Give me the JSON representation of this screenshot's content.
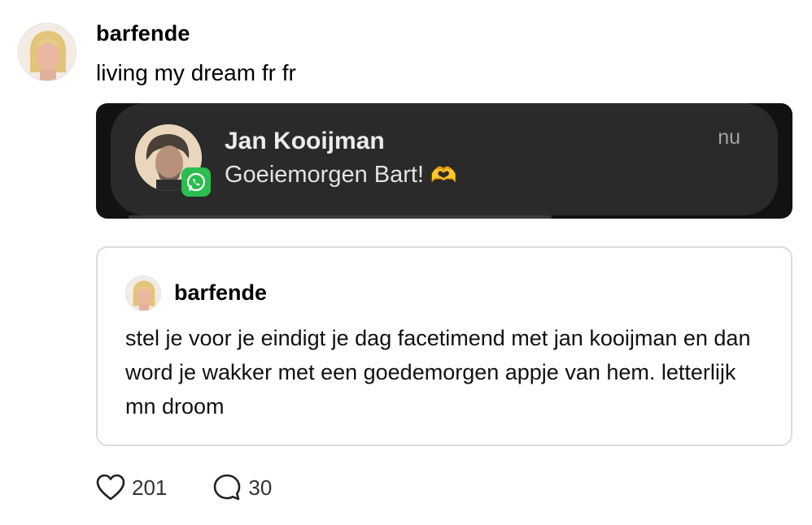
{
  "post": {
    "username": "barfende",
    "text": "living my dream fr fr"
  },
  "notification": {
    "sender": "Jan Kooijman",
    "message": "Goeiemorgen Bart!",
    "emoji": "🫶",
    "time": "nu",
    "app_icon": "whatsapp-icon"
  },
  "quoted_post": {
    "username": "barfende",
    "text": "stel je voor je eindigt je dag facetimend met jan kooijman en dan word je wakker met een goedemorgen appje van hem. letterlijk mn droom"
  },
  "actions": {
    "likes": "201",
    "comments": "30"
  },
  "colors": {
    "whatsapp_green": "#2bbd4f",
    "notification_bg": "#2a2a2a",
    "card_border": "#dcdcdc"
  }
}
